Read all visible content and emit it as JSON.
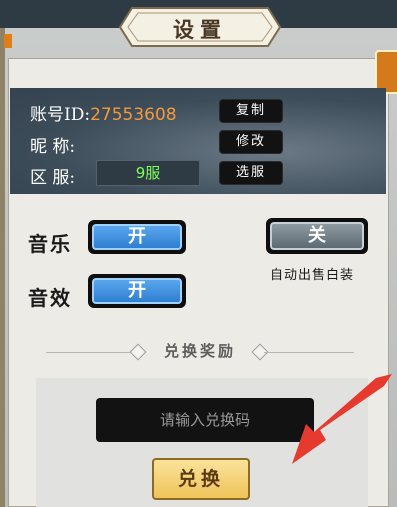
{
  "header": {
    "title": "设置"
  },
  "account": {
    "id_label": "账号ID:",
    "id_value": "27553608",
    "copy_label": "复制",
    "nickname_label": "昵  称:",
    "edit_label": "修改",
    "server_label": "区  服:",
    "server_value": "9服",
    "select_server_label": "选服"
  },
  "settings": {
    "music_label": "音乐",
    "music_state": "开",
    "sfx_label": "音效",
    "sfx_state": "开",
    "auto_sell_state": "关",
    "auto_sell_label": "自动出售白装"
  },
  "redeem": {
    "section_title": "兑换奖励",
    "code_placeholder": "请输入兑换码",
    "button_label": "兑换"
  },
  "colors": {
    "accent_orange": "#f59a3a",
    "server_green": "#7dff5a",
    "toggle_blue": "#2f7fd0",
    "gold_button": "#efc45a",
    "arrow_red": "#e63a2e"
  },
  "icons": [
    "arrow-pointer-icon"
  ]
}
